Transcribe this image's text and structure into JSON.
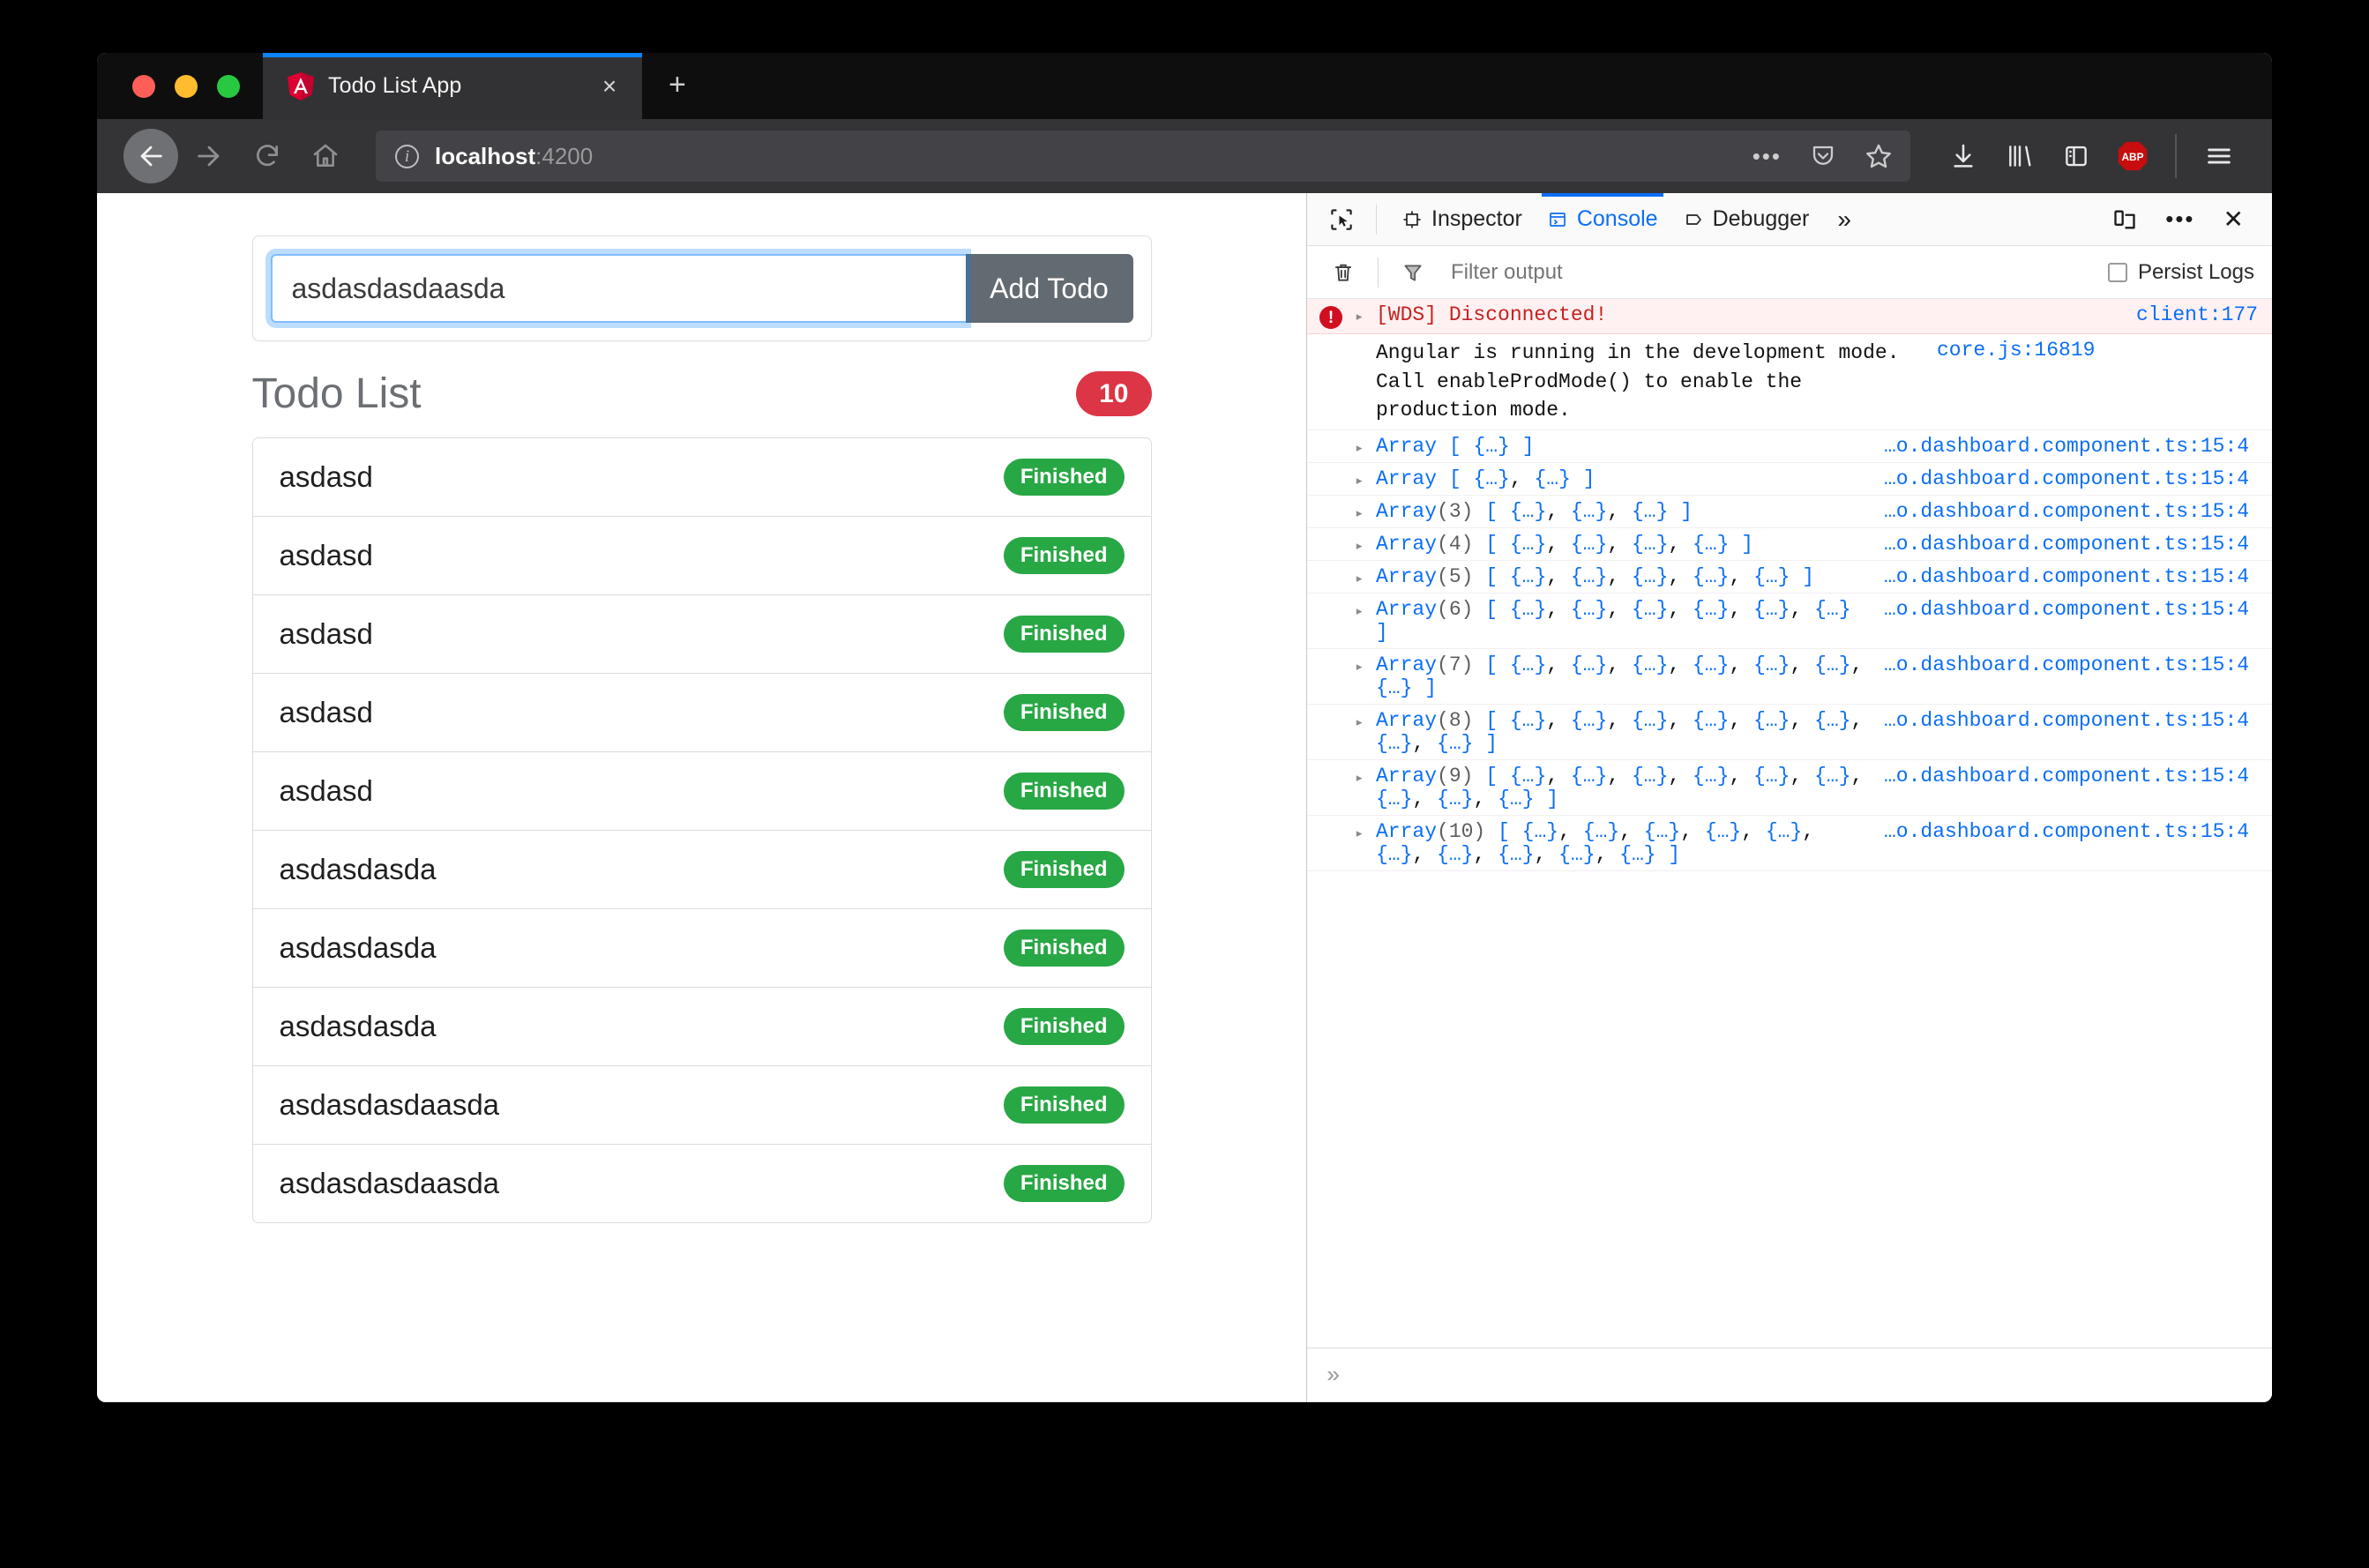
{
  "browser": {
    "tab": {
      "title": "Todo List App",
      "favicon": "angular-logo-icon",
      "close_label": "×"
    },
    "new_tab_label": "+",
    "nav": {
      "back": "back-arrow-icon",
      "forward": "forward-arrow-icon",
      "reload": "reload-icon",
      "home": "home-icon"
    },
    "url": {
      "host": "localhost",
      "port": ":4200",
      "info_icon": "i"
    },
    "url_actions": {
      "dots": "•••",
      "pocket": "pocket-icon",
      "bookmark": "star-icon"
    },
    "toolbar_icons": {
      "downloads": "downloads-icon",
      "library": "library-icon",
      "sidebar": "sidebar-icon",
      "adblock": "ABP",
      "menu": "hamburger-menu-icon"
    }
  },
  "app": {
    "input": {
      "value": "asdasdasdaasda",
      "placeholder": ""
    },
    "add_button": "Add Todo",
    "list_title": "Todo List",
    "count_badge": "10",
    "todos": [
      {
        "text": "asdasd",
        "status": "Finished"
      },
      {
        "text": "asdasd",
        "status": "Finished"
      },
      {
        "text": "asdasd",
        "status": "Finished"
      },
      {
        "text": "asdasd",
        "status": "Finished"
      },
      {
        "text": "asdasd",
        "status": "Finished"
      },
      {
        "text": "asdasdasda",
        "status": "Finished"
      },
      {
        "text": "asdasdasda",
        "status": "Finished"
      },
      {
        "text": "asdasdasda",
        "status": "Finished"
      },
      {
        "text": "asdasdasdaasda",
        "status": "Finished"
      },
      {
        "text": "asdasdasdaasda",
        "status": "Finished"
      }
    ]
  },
  "devtools": {
    "picker_icon": "element-picker-icon",
    "tabs": [
      {
        "label": "Inspector",
        "icon": "inspector-icon",
        "active": false
      },
      {
        "label": "Console",
        "icon": "console-icon",
        "active": true
      },
      {
        "label": "Debugger",
        "icon": "debugger-icon",
        "active": false
      }
    ],
    "more_tabs": "»",
    "right_icons": {
      "responsive": "responsive-design-mode-icon",
      "meatball": "•••",
      "close": "✕"
    },
    "filter": {
      "trash_icon": "trash-icon",
      "funnel_icon": "funnel-icon",
      "placeholder": "Filter output",
      "value": ""
    },
    "persist_logs": {
      "label": "Persist Logs",
      "checked": false
    },
    "logs": [
      {
        "kind": "error",
        "arrow": "▸",
        "text": "[WDS] Disconnected!",
        "source": "client:177"
      },
      {
        "kind": "plain",
        "text": "Angular is running in the development mode. Call enableProdMode() to enable the production mode.",
        "source": "core.js:16819"
      },
      {
        "kind": "array",
        "arrow": "▸",
        "type": "Array",
        "length": "",
        "items": 1,
        "source": "…o.dashboard.component.ts:15:4"
      },
      {
        "kind": "array",
        "arrow": "▸",
        "type": "Array",
        "length": "",
        "items": 2,
        "source": "…o.dashboard.component.ts:15:4"
      },
      {
        "kind": "array",
        "arrow": "▸",
        "type": "Array",
        "length": "(3)",
        "items": 3,
        "source": "…o.dashboard.component.ts:15:4"
      },
      {
        "kind": "array",
        "arrow": "▸",
        "type": "Array",
        "length": "(4)",
        "items": 4,
        "source": "…o.dashboard.component.ts:15:4"
      },
      {
        "kind": "array",
        "arrow": "▸",
        "type": "Array",
        "length": "(5)",
        "items": 5,
        "source": "…o.dashboard.component.ts:15:4"
      },
      {
        "kind": "array",
        "arrow": "▸",
        "type": "Array",
        "length": "(6)",
        "items": 6,
        "source": "…o.dashboard.component.ts:15:4"
      },
      {
        "kind": "array",
        "arrow": "▸",
        "type": "Array",
        "length": "(7)",
        "items": 7,
        "source": "…o.dashboard.component.ts:15:4"
      },
      {
        "kind": "array",
        "arrow": "▸",
        "type": "Array",
        "length": "(8)",
        "items": 8,
        "source": "…o.dashboard.component.ts:15:4"
      },
      {
        "kind": "array",
        "arrow": "▸",
        "type": "Array",
        "length": "(9)",
        "items": 9,
        "source": "…o.dashboard.component.ts:15:4"
      },
      {
        "kind": "array",
        "arrow": "▸",
        "type": "Array",
        "length": "(10)",
        "items": 10,
        "source": "…o.dashboard.component.ts:15:4"
      }
    ],
    "prompt": "»"
  },
  "colors": {
    "accent_blue": "#0b6ef5",
    "badge_red": "#dc3545",
    "status_green": "#28a745",
    "button_grey": "#636b72",
    "error_text": "#c5221f",
    "chrome_dark": "#343437"
  }
}
